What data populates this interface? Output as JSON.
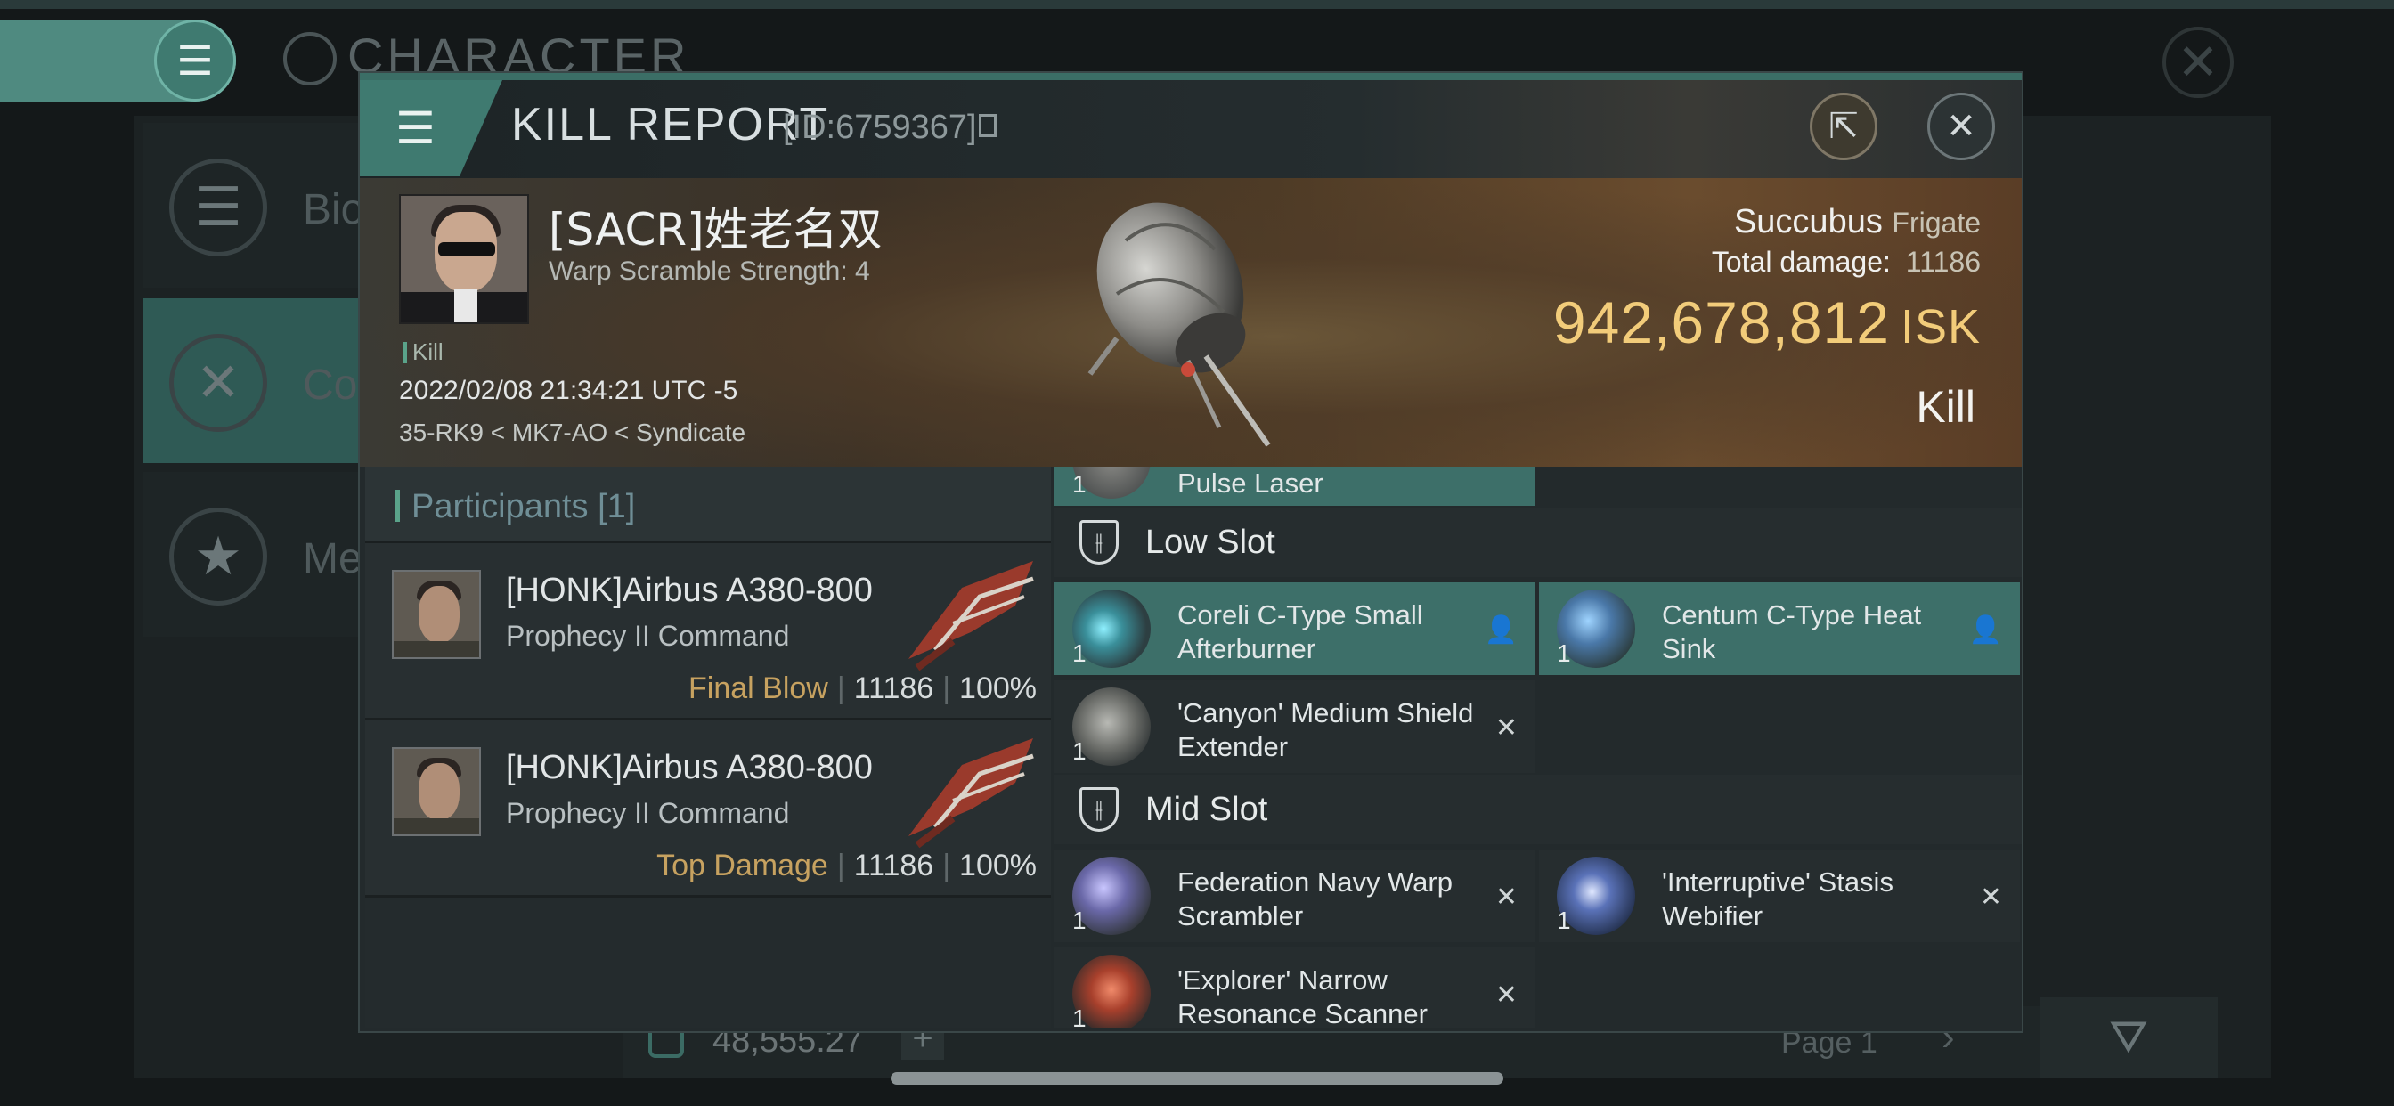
{
  "background": {
    "title": "CHARACTER",
    "side_items": [
      {
        "label": "Bio",
        "icon": "list-icon"
      },
      {
        "label": "Con",
        "icon": "crossed-swords-icon"
      },
      {
        "label": "Me",
        "icon": "star-badge-icon"
      }
    ],
    "isk_balance": "48,555.27",
    "page_label": "Page 1"
  },
  "window": {
    "title": "KILL REPORT",
    "id_label": "[ID:6759367]"
  },
  "victim": {
    "name": "[SACR]姓老名双",
    "warp_scramble": "Warp Scramble Strength: 4",
    "kill_tag": "Kill",
    "datetime": "2022/02/08 21:34:21 UTC -5",
    "location": "35-RK9 < MK7-AO < Syndicate",
    "ship_name": "Succubus",
    "ship_class": "Frigate",
    "total_damage_label": "Total damage:",
    "total_damage": "11186",
    "isk_value": "942,678,812",
    "isk_unit": "ISK",
    "result": "Kill"
  },
  "participants": {
    "header": "Participants [1]",
    "rows": [
      {
        "name": "[HONK]Airbus A380-800",
        "ship": "Prophecy II Command",
        "role": "Final Blow",
        "damage": "11186",
        "percent": "100%"
      },
      {
        "name": "[HONK]Airbus A380-800",
        "ship": "Prophecy II Command",
        "role": "Top Damage",
        "damage": "11186",
        "percent": "100%"
      }
    ]
  },
  "fittings": {
    "partial_item": {
      "name": "Pulse Laser",
      "qty": "1"
    },
    "low_slot": {
      "title": "Low Slot",
      "items": [
        {
          "name": "Coreli C-Type Small Afterburner",
          "qty": "1",
          "status": "fitted"
        },
        {
          "name": "Centum C-Type Heat Sink",
          "qty": "1",
          "status": "fitted"
        },
        {
          "name": "'Canyon' Medium Shield Extender",
          "qty": "1",
          "status": "destroyed"
        }
      ]
    },
    "mid_slot": {
      "title": "Mid Slot",
      "items": [
        {
          "name": "Federation Navy Warp Scrambler",
          "qty": "1",
          "status": "destroyed"
        },
        {
          "name": "'Interruptive' Stasis Webifier",
          "qty": "1",
          "status": "destroyed"
        },
        {
          "name": "'Explorer' Narrow Resonance Scanner",
          "qty": "1",
          "status": "destroyed"
        }
      ]
    }
  },
  "colors": {
    "accent_teal": "#3f7a70",
    "isk_gold": "#f2cc7a",
    "role_gold": "#c7a260"
  }
}
